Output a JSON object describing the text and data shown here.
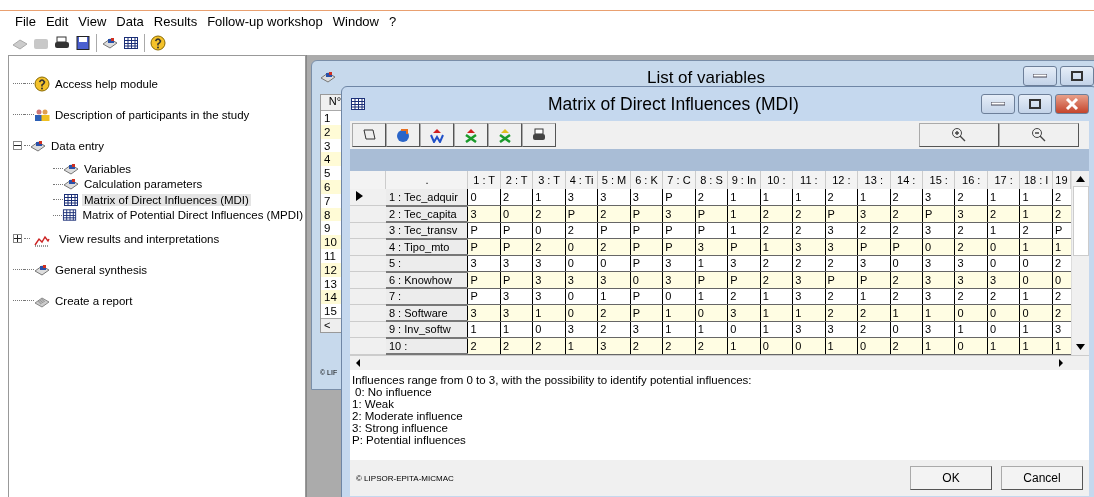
{
  "menu": [
    "File",
    "Edit",
    "View",
    "Data",
    "Results",
    "Follow-up workshop",
    "Window",
    "?"
  ],
  "tree": [
    {
      "label": "Access help module",
      "kind": "help",
      "selected": false
    },
    {
      "label": "Description of participants in the study",
      "kind": "people",
      "selected": false
    },
    {
      "label": "Data entry",
      "kind": "entry",
      "selected": false,
      "expanded": true,
      "children": [
        {
          "label": "Variables",
          "kind": "entry",
          "selected": false
        },
        {
          "label": "Calculation parameters",
          "kind": "entry",
          "selected": false
        },
        {
          "label": "Matrix of Direct Influences (MDI)",
          "kind": "table",
          "selected": true
        },
        {
          "label": "Matrix of Potential Direct Influences (MPDI)",
          "kind": "table",
          "selected": false
        }
      ]
    },
    {
      "label": "View results and interpretations",
      "kind": "chart",
      "selected": false,
      "expanded": false
    },
    {
      "label": "General synthesis",
      "kind": "entry",
      "selected": false
    },
    {
      "label": "Create a report",
      "kind": "report",
      "selected": false
    }
  ],
  "back_window": {
    "title": "List of variables",
    "header": "N°",
    "rows": [
      "1",
      "2",
      "3",
      "4",
      "5",
      "6",
      "7",
      "8",
      "9",
      "10",
      "11",
      "12",
      "13",
      "14",
      "15"
    ],
    "scroll_left": "<",
    "footer": "© LIF"
  },
  "mdi": {
    "title": "Matrix of Direct Influences (MDI)",
    "corner": ".",
    "columns": [
      "1 : T",
      "2 : T",
      "3 : T",
      "4 : Ti",
      "5 : M",
      "6 : K",
      "7 : C",
      "8 : S",
      "9 : In",
      "10 :",
      "11 :",
      "12 :",
      "13 :",
      "14 :",
      "15 :",
      "16 :",
      "17 :",
      "18 : I",
      "19"
    ],
    "rows": [
      {
        "label": "1 : Tec_adquir",
        "selected": true,
        "cells": [
          "0",
          "2",
          "1",
          "3",
          "3",
          "3",
          "P",
          "2",
          "1",
          "1",
          "1",
          "2",
          "1",
          "2",
          "3",
          "2",
          "1",
          "1",
          "2"
        ]
      },
      {
        "label": "2 : Tec_capita",
        "selected": false,
        "cells": [
          "3",
          "0",
          "2",
          "P",
          "2",
          "P",
          "3",
          "P",
          "1",
          "2",
          "2",
          "P",
          "3",
          "2",
          "P",
          "3",
          "2",
          "1",
          "2"
        ]
      },
      {
        "label": "3 : Tec_transv",
        "selected": false,
        "cells": [
          "P",
          "P",
          "0",
          "2",
          "P",
          "P",
          "P",
          "P",
          "1",
          "2",
          "2",
          "3",
          "2",
          "2",
          "3",
          "2",
          "1",
          "2",
          "P"
        ]
      },
      {
        "label": "4 : Tipo_mto",
        "selected": false,
        "cells": [
          "P",
          "P",
          "2",
          "0",
          "2",
          "P",
          "P",
          "3",
          "P",
          "1",
          "3",
          "3",
          "P",
          "P",
          "0",
          "2",
          "0",
          "1",
          "1"
        ]
      },
      {
        "label": "5 :",
        "selected": false,
        "cells": [
          "3",
          "3",
          "3",
          "0",
          "0",
          "P",
          "3",
          "1",
          "3",
          "2",
          "2",
          "2",
          "3",
          "0",
          "3",
          "3",
          "0",
          "0",
          "2"
        ]
      },
      {
        "label": "6 : Knowhow",
        "selected": false,
        "cells": [
          "P",
          "P",
          "3",
          "3",
          "3",
          "0",
          "3",
          "P",
          "P",
          "2",
          "3",
          "P",
          "P",
          "2",
          "3",
          "3",
          "3",
          "0",
          "0"
        ]
      },
      {
        "label": "7 :",
        "selected": false,
        "cells": [
          "P",
          "3",
          "3",
          "0",
          "1",
          "P",
          "0",
          "1",
          "2",
          "1",
          "3",
          "2",
          "1",
          "2",
          "3",
          "2",
          "2",
          "1",
          "2"
        ]
      },
      {
        "label": "8 : Software",
        "selected": false,
        "cells": [
          "3",
          "3",
          "1",
          "0",
          "2",
          "P",
          "1",
          "0",
          "3",
          "1",
          "1",
          "2",
          "2",
          "1",
          "1",
          "0",
          "0",
          "0",
          "2"
        ]
      },
      {
        "label": "9 : Inv_softw",
        "selected": false,
        "cells": [
          "1",
          "1",
          "0",
          "3",
          "2",
          "3",
          "1",
          "1",
          "0",
          "1",
          "3",
          "3",
          "2",
          "0",
          "3",
          "1",
          "0",
          "1",
          "3"
        ]
      },
      {
        "label": "10 :",
        "selected": false,
        "cells": [
          "2",
          "2",
          "2",
          "1",
          "3",
          "2",
          "2",
          "2",
          "1",
          "0",
          "0",
          "1",
          "0",
          "2",
          "1",
          "0",
          "1",
          "1",
          "1"
        ]
      }
    ],
    "legend": [
      "Influences range from 0 to 3, with the possibility to identify potential influences:",
      "0: No influence",
      "1: Weak",
      "2: Moderate influence",
      "3: Strong influence",
      "P: Potential influences"
    ],
    "copyright": "© LIPSOR-EPITA-MICMAC",
    "buttons": [
      "OK",
      "Cancel"
    ]
  }
}
